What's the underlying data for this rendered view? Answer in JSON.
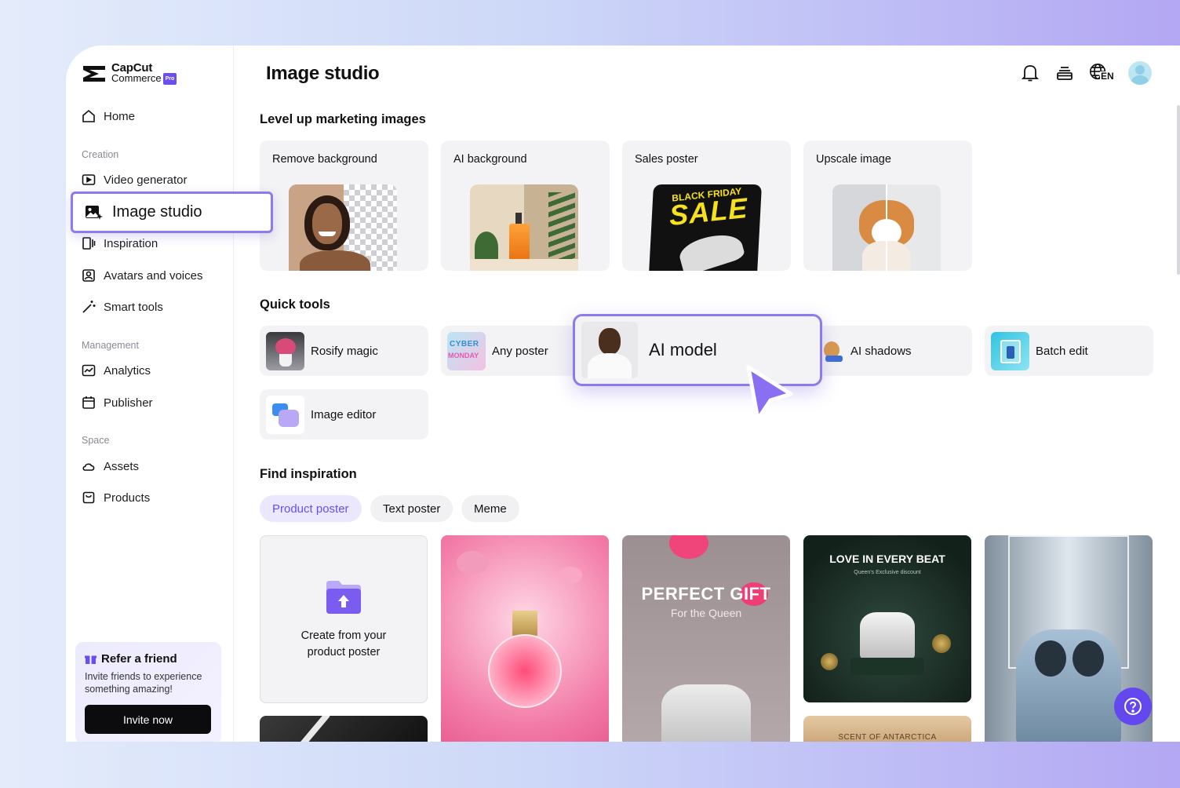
{
  "app": {
    "brand_line1": "CapCut",
    "brand_line2": "Commerce",
    "brand_badge": "Pro"
  },
  "sidebar": {
    "home": "Home",
    "section_creation": "Creation",
    "video_generator": "Video generator",
    "image_studio": "Image studio",
    "inspiration": "Inspiration",
    "avatars": "Avatars and voices",
    "smart_tools": "Smart tools",
    "section_management": "Management",
    "analytics": "Analytics",
    "publisher": "Publisher",
    "section_space": "Space",
    "assets": "Assets",
    "products": "Products",
    "refer_title": "Refer a friend",
    "refer_desc": "Invite friends to experience something amazing!",
    "refer_button": "Invite now"
  },
  "header": {
    "title": "Image studio",
    "lang": "EN"
  },
  "marketing": {
    "title": "Level up marketing images",
    "cards": [
      "Remove background",
      "AI background",
      "Sales poster",
      "Upscale image"
    ],
    "sale_small": "BLACK FRIDAY",
    "sale_big": "SALE"
  },
  "quick_tools": {
    "title": "Quick tools",
    "rosify": "Rosify magic",
    "any_poster": "Any poster",
    "cyber_line1": "CYBER",
    "cyber_line2": "MONDAY",
    "ai_model": "AI model",
    "ai_shadows": "AI shadows",
    "batch_edit": "Batch edit",
    "image_editor": "Image editor"
  },
  "inspiration": {
    "title": "Find inspiration",
    "tabs": [
      "Product poster",
      "Text poster",
      "Meme"
    ],
    "upload_text_1": "Create from your",
    "upload_text_2": "product poster",
    "gift_title": "PERFECT GIFT",
    "gift_sub": "For the Queen",
    "love_title": "LOVE IN EVERY BEAT",
    "love_sub": "Queen's Exclusive discount",
    "scent_title": "SCENT OF ANTARCTICA"
  },
  "colors": {
    "accent": "#6b4df0",
    "highlight_border": "#8b7bef"
  }
}
